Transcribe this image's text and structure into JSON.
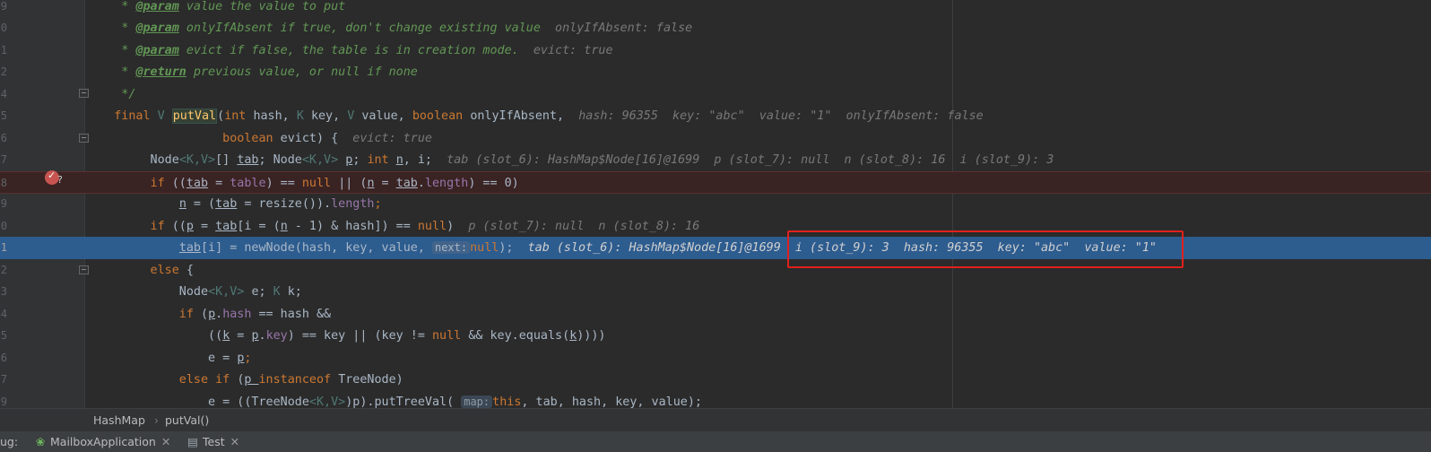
{
  "editor": {
    "lines": [
      {
        "num": "9",
        "tokens": [
          [
            "doc",
            "     * "
          ],
          [
            "doctag",
            "@param"
          ],
          [
            "doc",
            " "
          ],
          [
            "doc",
            "value the value to put"
          ]
        ]
      },
      {
        "num": "0",
        "tokens": [
          [
            "doc",
            "     * "
          ],
          [
            "doctag",
            "@param"
          ],
          [
            "doc",
            " "
          ],
          [
            "doc",
            "onlyIfAbsent if true, don't change existing value  "
          ],
          [
            "hint",
            "onlyIfAbsent: false"
          ]
        ]
      },
      {
        "num": "1",
        "tokens": [
          [
            "doc",
            "     * "
          ],
          [
            "doctag",
            "@param"
          ],
          [
            "doc",
            " "
          ],
          [
            "doc",
            "evict if false, the table is in creation mode.  "
          ],
          [
            "hint",
            "evict: true"
          ]
        ]
      },
      {
        "num": "2",
        "tokens": [
          [
            "doc",
            "     * "
          ],
          [
            "doctag",
            "@return"
          ],
          [
            "doc",
            " previous value, or null if none"
          ]
        ]
      },
      {
        "num": "4",
        "tokens": [
          [
            "doc",
            "     */"
          ]
        ]
      },
      {
        "num": "5",
        "tokens": [
          [
            "kw",
            "    final "
          ],
          [
            "typ",
            "V "
          ],
          [
            "mthhl",
            "putVal"
          ],
          [
            "",
            "("
          ],
          [
            "kw",
            "int "
          ],
          [
            "",
            "hash, "
          ],
          [
            "typ",
            "K "
          ],
          [
            "",
            "key, "
          ],
          [
            "typ",
            "V "
          ],
          [
            "",
            "value, "
          ],
          [
            "kw",
            "boolean "
          ],
          [
            "",
            "onlyIfAbsent,  "
          ],
          [
            "hint",
            "hash: 96355  key: \"abc\"  value: \"1\"  onlyIfAbsent: false"
          ]
        ]
      },
      {
        "num": "6",
        "tokens": [
          [
            "kw",
            "                   boolean "
          ],
          [
            "",
            "evict) {  "
          ],
          [
            "hint",
            "evict: true"
          ]
        ]
      },
      {
        "num": "7",
        "tokens": [
          [
            "",
            "         Node"
          ],
          [
            "typ",
            "<K,V>"
          ],
          [
            "",
            "[] "
          ],
          [
            "ul",
            "tab"
          ],
          [
            "",
            "; Node"
          ],
          [
            "typ",
            "<K,V> "
          ],
          [
            "ul",
            "p"
          ],
          [
            "",
            "; "
          ],
          [
            "kw",
            "int "
          ],
          [
            "ul",
            "n"
          ],
          [
            "",
            ", i;  "
          ],
          [
            "hint",
            "tab (slot_6): HashMap$Node[16]@1699  p (slot_7): null  n (slot_8): 16  i (slot_9): 3"
          ]
        ]
      },
      {
        "num": "8",
        "tokens": [
          [
            "kw",
            "         if "
          ],
          [
            "",
            "(("
          ],
          [
            "ul",
            "tab"
          ],
          [
            "",
            " = "
          ],
          [
            "fld",
            "table"
          ],
          [
            "",
            ") == "
          ],
          [
            "kw",
            "null "
          ],
          [
            "",
            "|| ("
          ],
          [
            "ul",
            "n"
          ],
          [
            "",
            " = "
          ],
          [
            "ul",
            "tab"
          ],
          [
            "",
            "."
          ],
          [
            "fld",
            "length"
          ],
          [
            "",
            ") == 0)"
          ]
        ]
      },
      {
        "num": "9",
        "tokens": [
          [
            "",
            "             "
          ],
          [
            "ul",
            "n"
          ],
          [
            "",
            " = ("
          ],
          [
            "ul",
            "tab"
          ],
          [
            "",
            " = resize())."
          ],
          [
            "fld",
            "length"
          ],
          [
            "kw",
            ";"
          ]
        ]
      },
      {
        "num": "0",
        "tokens": [
          [
            "kw",
            "         if "
          ],
          [
            "",
            "(("
          ],
          [
            "ul",
            "p"
          ],
          [
            "",
            " = "
          ],
          [
            "ul",
            "tab"
          ],
          [
            "",
            "[i = ("
          ],
          [
            "ul",
            "n"
          ],
          [
            "",
            " - 1) & hash]) == "
          ],
          [
            "kw",
            "null"
          ],
          [
            "",
            ")  "
          ],
          [
            "hint",
            "p (slot_7): null  n (slot_8): 16"
          ]
        ]
      },
      {
        "num": "1",
        "tokens": [
          [
            "",
            "             "
          ],
          [
            "ul",
            "tab"
          ],
          [
            "",
            "[i] = newNode(hash, key, value, "
          ],
          [
            "param",
            "next:"
          ],
          [
            "kw",
            "null"
          ],
          [
            "",
            ");  "
          ],
          [
            "hint",
            "tab (slot_6): HashMap$Node[16]@1699  i (slot_9): 3  hash: 96355  key: \"abc\"  value: \"1\""
          ]
        ]
      },
      {
        "num": "2",
        "tokens": [
          [
            "kw",
            "         else "
          ],
          [
            "",
            "{"
          ]
        ]
      },
      {
        "num": "3",
        "tokens": [
          [
            "",
            "             Node"
          ],
          [
            "typ",
            "<K,V> "
          ],
          [
            "",
            "e; "
          ],
          [
            "typ",
            "K "
          ],
          [
            "",
            "k;"
          ]
        ]
      },
      {
        "num": "4",
        "tokens": [
          [
            "kw",
            "             if "
          ],
          [
            "",
            "("
          ],
          [
            "ul",
            "p"
          ],
          [
            "",
            "."
          ],
          [
            "fld",
            "hash"
          ],
          [
            "",
            " == hash &&"
          ]
        ]
      },
      {
        "num": "5",
        "tokens": [
          [
            "",
            "                 (("
          ],
          [
            "ul",
            "k"
          ],
          [
            "",
            " = "
          ],
          [
            "ul",
            "p"
          ],
          [
            "",
            "."
          ],
          [
            "fld",
            "key"
          ],
          [
            "",
            ") == key || (key != "
          ],
          [
            "kw",
            "null "
          ],
          [
            "",
            "&& key.equals("
          ],
          [
            "ul",
            "k"
          ],
          [
            "",
            "))))"
          ]
        ]
      },
      {
        "num": "6",
        "tokens": [
          [
            "",
            "                 e = "
          ],
          [
            "ul",
            "p"
          ],
          [
            "kw",
            ";"
          ]
        ]
      },
      {
        "num": "7",
        "tokens": [
          [
            "kw",
            "             else if "
          ],
          [
            "",
            "("
          ],
          [
            "ul",
            "p "
          ],
          [
            "kw",
            "instanceof "
          ],
          [
            "",
            "TreeNode)"
          ]
        ]
      },
      {
        "num": "9",
        "tokens": [
          [
            "",
            "                 e = ((TreeNode"
          ],
          [
            "typ",
            "<K,V>"
          ],
          [
            "",
            ")p).putTreeVal( "
          ],
          [
            "param",
            "map:"
          ],
          [
            "kw",
            "this"
          ],
          [
            "",
            ", tab, hash, key, value);"
          ]
        ]
      }
    ]
  },
  "breadcrumb": {
    "items": [
      "HashMap",
      "putVal()"
    ],
    "separator": "›"
  },
  "debug_tabs": {
    "label": "ug:",
    "tabs": [
      {
        "icon": "spring-app-icon",
        "glyph": "❀",
        "label": "MailboxApplication",
        "close": "✕"
      },
      {
        "icon": "test-run-icon",
        "glyph": "▤",
        "label": "Test",
        "close": "✕"
      }
    ]
  },
  "colors": {
    "current_line": "#2d5c8f",
    "breakpoint": "#c75450",
    "highlight_box": "#e0201c"
  }
}
